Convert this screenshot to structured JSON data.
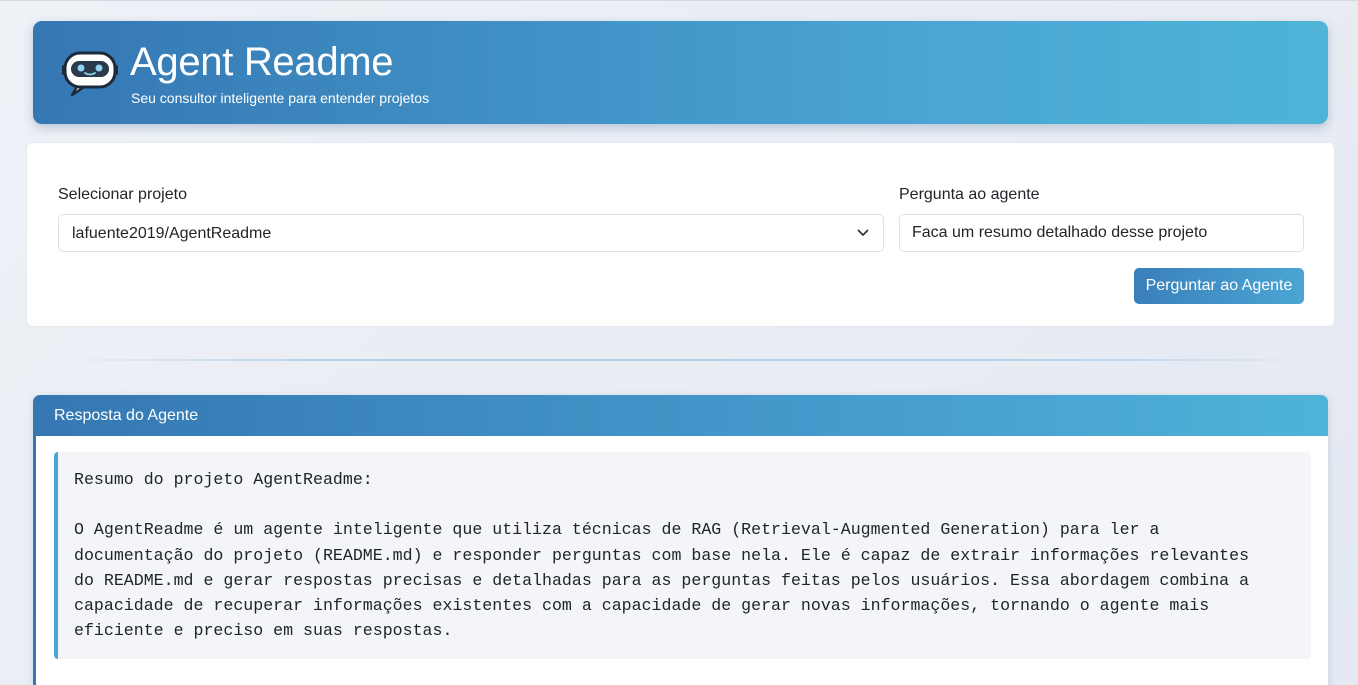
{
  "header": {
    "title": "Agent Readme",
    "subtitle": "Seu consultor inteligente para entender projetos",
    "logo_icon": "robot-chat-icon"
  },
  "form": {
    "project_label": "Selecionar projeto",
    "project_selected": "lafuente2019/AgentReadme",
    "question_label": "Pergunta ao agente",
    "question_value": "Faca um resumo detalhado desse projeto",
    "ask_button_label": "Perguntar ao Agente"
  },
  "response": {
    "title": "Resposta do Agente",
    "text": "Resumo do projeto AgentReadme:\n\nO AgentReadme é um agente inteligente que utiliza técnicas de RAG (Retrieval-Augmented Generation) para ler a\ndocumentação do projeto (README.md) e responder perguntas com base nela. Ele é capaz de extrair informações relevantes\ndo README.md e gerar respostas precisas e detalhadas para as perguntas feitas pelos usuários. Essa abordagem combina a\ncapacidade de recuperar informações existentes com a capacidade de gerar novas informações, tornando o agente mais\neficiente e preciso em suas respostas."
  },
  "colors": {
    "accent_dark": "#3577b3",
    "accent_light": "#4fb4d8"
  }
}
